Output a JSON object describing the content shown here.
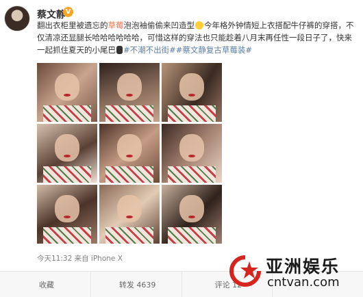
{
  "post": {
    "user": {
      "name": "蔡文静",
      "badge": "V"
    },
    "text": {
      "p1": "翻出衣柜里被遗忘的",
      "highlight": "草莓",
      "p2": "泡泡袖偷偷来凹造型",
      "p3": "今年格外钟情短上衣搭配牛仔裤的穿搭，不仅清凉还显腿长哈哈哈哈哈哈，可惜这样的穿法也只能趁着八月末再任性一段日子了，快来一起抓住夏天的小尾巴",
      "tag1": "#不潮不出街#",
      "tag2": "#蔡文静复古草莓装#"
    },
    "meta": "今天11:32 来自 iPhone X",
    "actions": {
      "favorite": "收藏",
      "repost": "转发 4639",
      "comment": "评论 12",
      "like": ""
    }
  },
  "watermark": {
    "name": "亚洲娱乐",
    "url": "cntvan.com"
  },
  "colors": {
    "highlight": "#eb7350",
    "tag": "#5c7ea6",
    "badge": "#f5a623",
    "logo_red": "#d6241f"
  },
  "icons": [
    "verified-badge-icon",
    "wink-emoji-icon",
    "dark-emoji-icon",
    "star-logo-icon"
  ]
}
